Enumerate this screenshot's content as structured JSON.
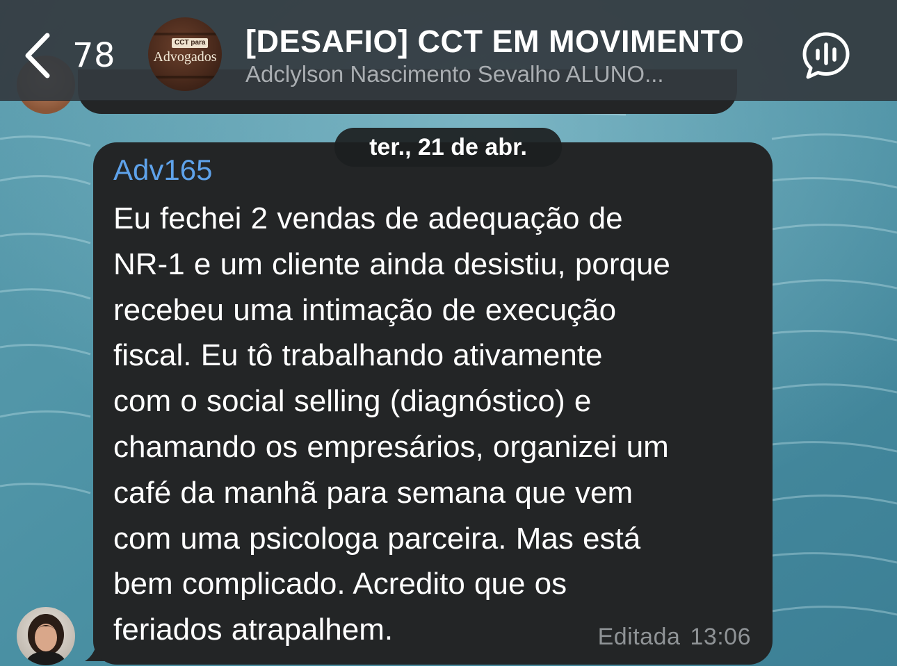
{
  "header": {
    "back_count": "78",
    "group_avatar_text_top": "CCT para",
    "group_avatar_text_main": "Advogados",
    "title": "[DESAFIO] CCT EM MOVIMENTO",
    "subtitle": "Adclylson Nascimento Sevalho ALUNO..."
  },
  "date_separator": "ter., 21 de abr.",
  "message": {
    "sender": "Adv165",
    "lines": [
      "Eu fechei 2 vendas de adequação de",
      "NR-1 e um cliente ainda desistiu, porque",
      "recebeu uma intimação de execução",
      "fiscal. Eu tô trabalhando ativamente",
      "com o social selling (diagnóstico) e",
      "chamando os empresários, organizei um",
      "café da manhã para semana que vem",
      "com uma psicologa parceira. Mas está",
      "bem complicado. Acredito que os",
      "feriados atrapalhem."
    ],
    "edited_label": "Editada",
    "time": "13:06"
  },
  "icons": {
    "back": "chevron-left-icon",
    "voice_chat": "voice-chat-icon"
  },
  "colors": {
    "header_bg": "#343a3f",
    "bubble_bg": "#232526",
    "sender_name": "#5ea2ea",
    "meta_text": "#8f9396",
    "wallpaper": "#4e93a6"
  }
}
